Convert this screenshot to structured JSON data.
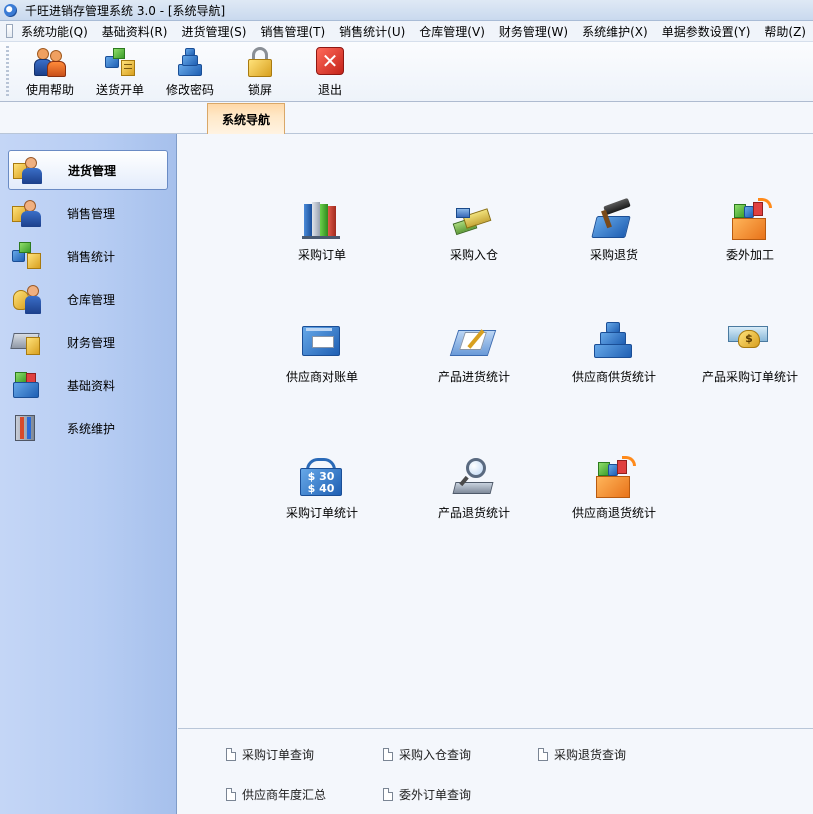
{
  "window": {
    "title": "千旺进销存管理系统 3.0 - [系统导航]"
  },
  "menubar": {
    "items": [
      "系统功能(Q)",
      "基础资料(R)",
      "进货管理(S)",
      "销售管理(T)",
      "销售统计(U)",
      "仓库管理(V)",
      "财务管理(W)",
      "系统维护(X)",
      "单据参数设置(Y)",
      "帮助(Z)"
    ]
  },
  "toolbar": {
    "help": "使用帮助",
    "delivery": "送货开单",
    "password": "修改密码",
    "lock": "锁屏",
    "exit": "退出"
  },
  "tab": {
    "label": "系统导航"
  },
  "sidebar": {
    "items": [
      {
        "label": "进货管理",
        "active": true
      },
      {
        "label": "销售管理"
      },
      {
        "label": "销售统计"
      },
      {
        "label": "仓库管理"
      },
      {
        "label": "财务管理"
      },
      {
        "label": "基础资料"
      },
      {
        "label": "系统维护"
      }
    ]
  },
  "main": {
    "items": [
      "采购订单",
      "采购入仓",
      "采购退货",
      "委外加工",
      "供应商对账单",
      "产品进货统计",
      "供应商供货统计",
      "产品采购订单统计",
      "采购订单统计",
      "产品退货统计",
      "供应商退货统计"
    ]
  },
  "quick_links": [
    "采购订单查询",
    "采购入仓查询",
    "采购退货查询",
    "供应商年度汇总",
    "委外订单查询"
  ],
  "colors": {
    "sidebar_bg": "#b7cdf3",
    "tab_active": "#ffe8c8",
    "main_bg": "#f4f7fc"
  }
}
